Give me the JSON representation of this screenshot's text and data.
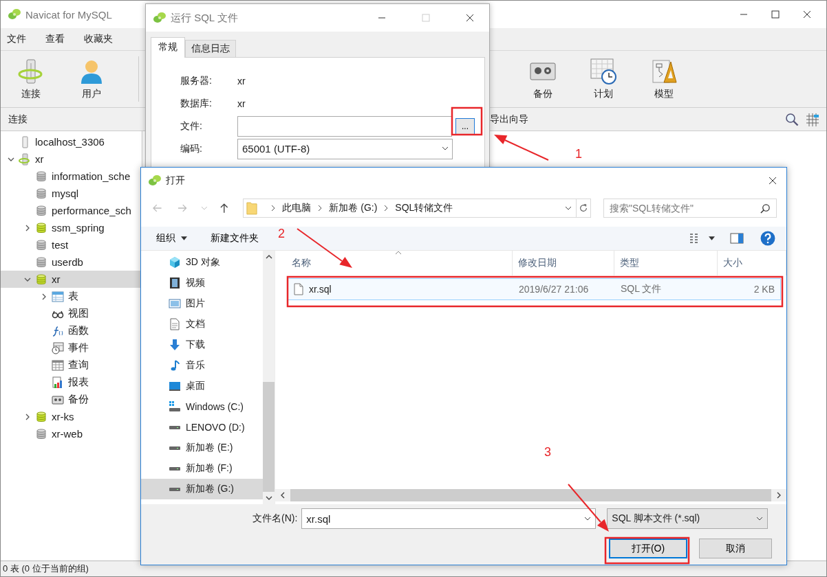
{
  "main_window": {
    "title": "Navicat for MySQL",
    "menu": [
      "文件",
      "查看",
      "收藏夹"
    ],
    "toolbar_left": [
      {
        "label": "连接",
        "kind": "connection"
      },
      {
        "label": "用户",
        "kind": "user"
      }
    ],
    "toolbar_right": [
      {
        "label": "备份",
        "kind": "backup"
      },
      {
        "label": "计划",
        "kind": "schedule"
      },
      {
        "label": "模型",
        "kind": "model"
      }
    ],
    "sidebar": {
      "header": "连接",
      "tree": [
        {
          "label": "localhost_3306",
          "kind": "server",
          "open": false
        },
        {
          "label": "xr",
          "kind": "server",
          "open": true,
          "expanded": true,
          "children": [
            {
              "label": "information_sche",
              "kind": "database",
              "open": false
            },
            {
              "label": "mysql",
              "kind": "database",
              "open": false
            },
            {
              "label": "performance_sch",
              "kind": "database",
              "open": false
            },
            {
              "label": "ssm_spring",
              "kind": "database",
              "open": true,
              "expanded": false
            },
            {
              "label": "test",
              "kind": "database",
              "open": false
            },
            {
              "label": "userdb",
              "kind": "database",
              "open": false
            },
            {
              "label": "xr",
              "kind": "database",
              "open": true,
              "expanded": true,
              "selected": true,
              "children": [
                {
                  "label": "表",
                  "kind": "table",
                  "expanded": false
                },
                {
                  "label": "视图",
                  "kind": "view"
                },
                {
                  "label": "函数",
                  "kind": "function"
                },
                {
                  "label": "事件",
                  "kind": "event"
                },
                {
                  "label": "查询",
                  "kind": "query"
                },
                {
                  "label": "报表",
                  "kind": "report"
                },
                {
                  "label": "备份",
                  "kind": "backup"
                }
              ]
            },
            {
              "label": "xr-ks",
              "kind": "database",
              "open": true,
              "expanded": false
            },
            {
              "label": "xr-web",
              "kind": "database",
              "open": false
            }
          ]
        }
      ]
    },
    "object_bar": {
      "label": "导出向导"
    },
    "status_bar": "0 表 (0 位于当前的组)"
  },
  "run_sql_dialog": {
    "title": "运行 SQL 文件",
    "tabs": [
      {
        "label": "常规",
        "selected": true
      },
      {
        "label": "信息日志",
        "selected": false
      }
    ],
    "fields": [
      {
        "kind": "text",
        "label": "服务器:",
        "value": "xr"
      },
      {
        "kind": "text",
        "label": "数据库:",
        "value": "xr"
      },
      {
        "kind": "file",
        "label": "文件:",
        "button": "..."
      },
      {
        "kind": "select",
        "label": "编码:",
        "value": "65001 (UTF-8)"
      }
    ]
  },
  "open_dialog": {
    "title": "打开",
    "path": [
      "此电脑",
      "新加卷 (G:)",
      "SQL转储文件"
    ],
    "search": {
      "placeholder": "搜索\"SQL转储文件\""
    },
    "organize": "组织",
    "new_folder": "新建文件夹",
    "nav": [
      {
        "label": "3D 对象",
        "kind": "cube",
        "selected": false
      },
      {
        "label": "视频",
        "kind": "video",
        "selected": false
      },
      {
        "label": "图片",
        "kind": "picture",
        "selected": false
      },
      {
        "label": "文档",
        "kind": "document",
        "selected": false
      },
      {
        "label": "下载",
        "kind": "download",
        "selected": false
      },
      {
        "label": "音乐",
        "kind": "music",
        "selected": false
      },
      {
        "label": "桌面",
        "kind": "desktop",
        "selected": false
      },
      {
        "label": "Windows (C:)",
        "kind": "system_drive",
        "selected": false
      },
      {
        "label": "LENOVO (D:)",
        "kind": "drive",
        "selected": false
      },
      {
        "label": "新加卷 (E:)",
        "kind": "drive",
        "selected": false
      },
      {
        "label": "新加卷 (F:)",
        "kind": "drive",
        "selected": false
      },
      {
        "label": "新加卷 (G:)",
        "kind": "drive",
        "selected": true
      }
    ],
    "columns": [
      "名称",
      "修改日期",
      "类型",
      "大小"
    ],
    "rows": [
      {
        "name": "xr.sql",
        "modified": "2019/6/27 21:06",
        "type": "SQL 文件",
        "size": "2 KB",
        "selected": true
      }
    ],
    "file_name_label": "文件名(N):",
    "file_name": "xr.sql",
    "filter": "SQL 脚本文件 (*.sql)",
    "buttons": [
      {
        "label": "打开(O)",
        "default": true
      },
      {
        "label": "取消",
        "default": false
      }
    ]
  },
  "annotations": [
    {
      "label": "1"
    },
    {
      "label": "2"
    },
    {
      "label": "3"
    }
  ]
}
